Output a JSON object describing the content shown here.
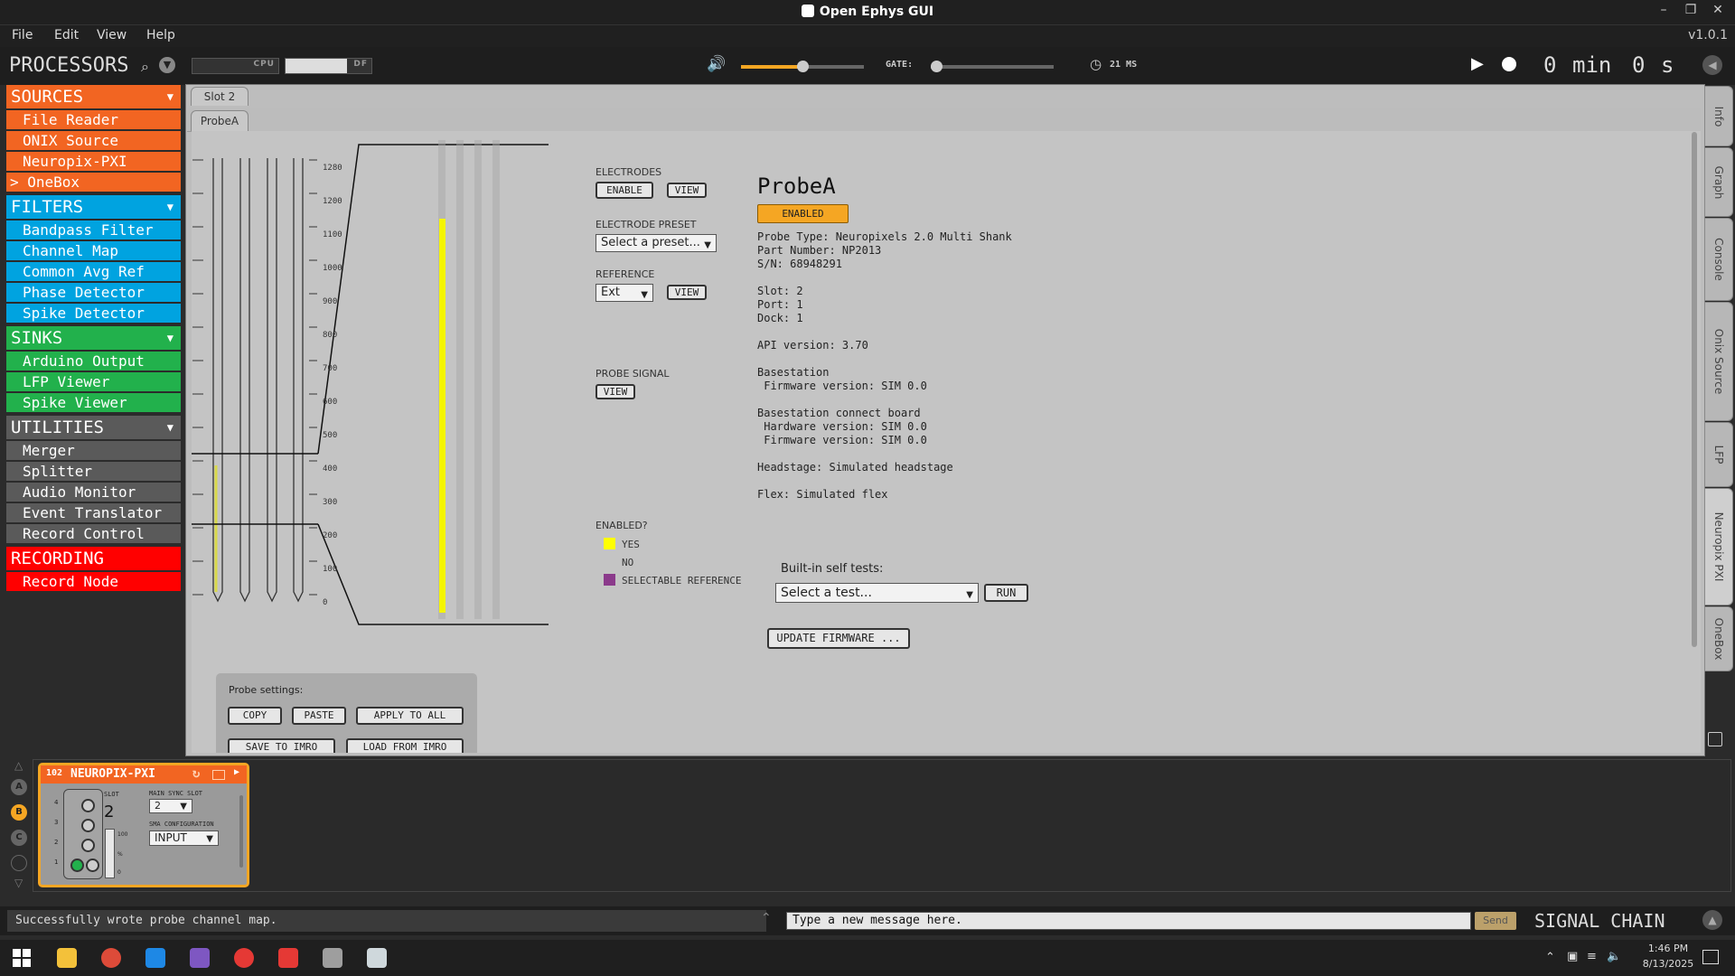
{
  "window": {
    "title": "Open Ephys GUI",
    "version": "v1.0.1"
  },
  "menu": [
    "File",
    "Edit",
    "View",
    "Help"
  ],
  "controlbar": {
    "processors_title": "PROCESSORS",
    "cpu_label": "CPU",
    "df_label": "DF",
    "gate_label": "GATE:",
    "latency": "21 MS",
    "volume_level": 0.5,
    "gate_level": 0.0,
    "time": {
      "min_value": "0",
      "min_label": "min",
      "sec_value": "0",
      "sec_label": "s"
    }
  },
  "processors": {
    "sources": {
      "label": "SOURCES",
      "color": "#f26522",
      "items": [
        "File Reader",
        "ONIX Source",
        "Neuropix-PXI",
        "> OneBox"
      ]
    },
    "filters": {
      "label": "FILTERS",
      "color": "#00a3e0",
      "items": [
        "Bandpass Filter",
        "Channel Map",
        "Common Avg Ref",
        "Phase Detector",
        "Spike Detector"
      ]
    },
    "sinks": {
      "label": "SINKS",
      "color": "#22b14c",
      "items": [
        "Arduino Output",
        "LFP Viewer",
        "Spike Viewer"
      ]
    },
    "utilities": {
      "label": "UTILITIES",
      "color": "#5a5a5a",
      "items": [
        "Merger",
        "Splitter",
        "Audio Monitor",
        "Event Translator",
        "Record Control"
      ]
    },
    "recording": {
      "label": "RECORDING",
      "color": "#ff0000",
      "items": [
        "Record Node"
      ]
    }
  },
  "editor": {
    "tabs": {
      "slot": "Slot 2",
      "probe": "ProbeA"
    },
    "axis_ticks": [
      "1280",
      "1200",
      "1100",
      "1000",
      "900",
      "800",
      "700",
      "600",
      "500",
      "400",
      "300",
      "200",
      "100",
      "0"
    ],
    "electrodes_label": "ELECTRODES",
    "enable_btn": "ENABLE",
    "view_btn": "VIEW",
    "electrode_preset_label": "ELECTRODE PRESET",
    "preset_placeholder": "Select a preset...",
    "reference_label": "REFERENCE",
    "reference_value": "Ext",
    "probe_signal_label": "PROBE SIGNAL",
    "enabled_q": "ENABLED?",
    "legend": [
      {
        "label": "YES",
        "color": "#ffff00"
      },
      {
        "label": "NO",
        "color": ""
      },
      {
        "label": "SELECTABLE REFERENCE",
        "color": "#8b3a8b"
      }
    ],
    "probe_name": "ProbeA",
    "probe_status": "ENABLED",
    "probe_info": "Probe Type: Neuropixels 2.0 Multi Shank\nPart Number: NP2013\nS/N: 68948291\n\nSlot: 2\nPort: 1\nDock: 1\n\nAPI version: 3.70\n\nBasestation\n Firmware version: SIM 0.0\n\nBasestation connect board\n Hardware version: SIM 0.0\n Firmware version: SIM 0.0\n\nHeadstage: Simulated headstage\n\nFlex: Simulated flex",
    "self_test_label": "Built-in self tests:",
    "self_test_placeholder": "Select a test...",
    "run_btn": "RUN",
    "update_fw_btn": "UPDATE FIRMWARE ...",
    "probe_settings_label": "Probe settings:",
    "copy_btn": "COPY",
    "paste_btn": "PASTE",
    "apply_all_btn": "APPLY TO ALL",
    "save_imro_btn": "SAVE TO IMRO",
    "load_imro_btn": "LOAD FROM IMRO"
  },
  "side_tabs": [
    "Info",
    "Graph",
    "Console",
    "Onix Source",
    "LFP",
    "Neuropix PXI",
    "OneBox"
  ],
  "signal_chain": {
    "node_id": "102",
    "node_name": "NEUROPIX-PXI",
    "slot_label": "SLOT",
    "slot_value": "2",
    "main_sync_label": "MAIN SYNC SLOT",
    "main_sync_value": "2",
    "sma_label": "SMA CONFIGURATION",
    "sma_value": "INPUT",
    "port_numbers": [
      "4",
      "3",
      "2",
      "1"
    ],
    "meter_ticks": [
      "100",
      "%",
      "0"
    ],
    "nav_buttons": [
      "A",
      "B",
      "C"
    ],
    "title": "SIGNAL CHAIN"
  },
  "status": {
    "message": "Successfully wrote probe channel map.",
    "input_placeholder": "Type a new message here.",
    "send": "Send"
  },
  "taskbar": {
    "time": "1:46 PM",
    "date": "8/13/2025"
  }
}
